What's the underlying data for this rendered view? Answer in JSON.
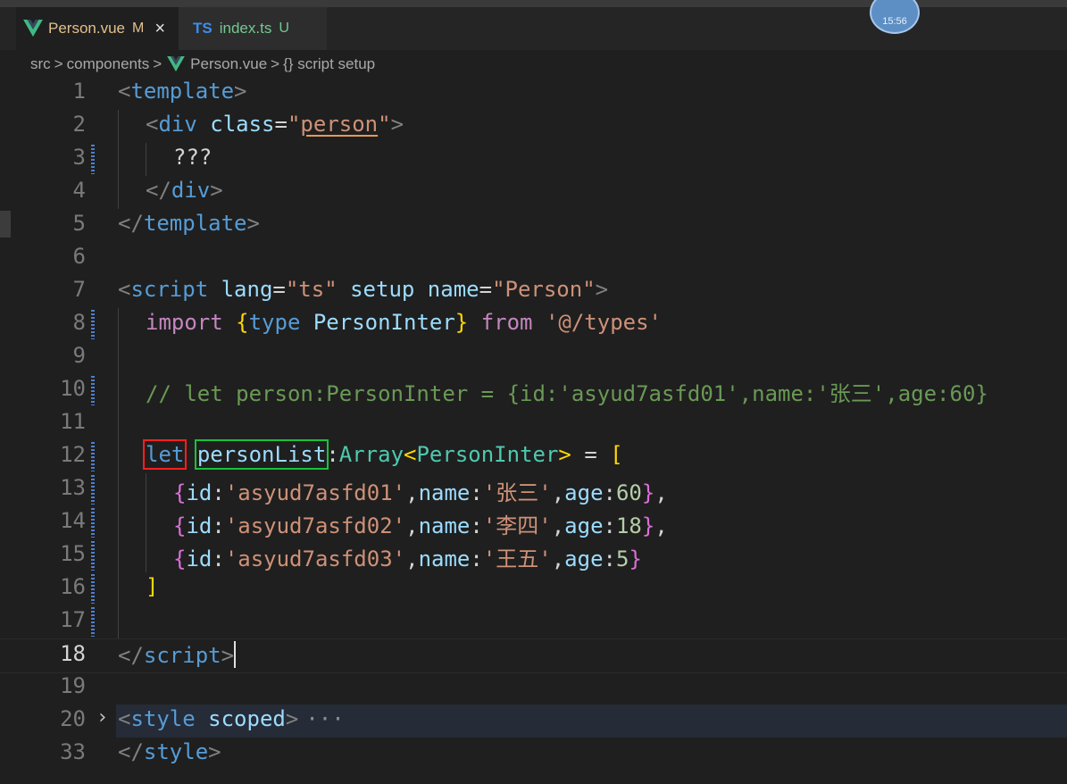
{
  "tabs": [
    {
      "label": "Person.vue",
      "flag": "M",
      "close": "×"
    },
    {
      "badge": "TS",
      "label": "index.ts",
      "flag": "U"
    }
  ],
  "clock": "15:56",
  "breadcrumb": {
    "parts": [
      "src",
      "components",
      "Person.vue",
      "{} script setup"
    ],
    "sep": ">"
  },
  "line_numbers": [
    "1",
    "2",
    "3",
    "4",
    "5",
    "6",
    "7",
    "8",
    "9",
    "10",
    "11",
    "12",
    "13",
    "14",
    "15",
    "16",
    "17",
    "18",
    "19",
    "20",
    "33"
  ],
  "code": {
    "l1": {
      "open": "<",
      "tag": "template",
      "close": ">"
    },
    "l2": {
      "open": "<",
      "tag": "div",
      "attr": " class",
      "eq": "=",
      "q1": "\"",
      "val": "person",
      "q2": "\"",
      "close": ">"
    },
    "l3": {
      "text": "???"
    },
    "l4": {
      "open": "</",
      "tag": "div",
      "close": ">"
    },
    "l5": {
      "open": "</",
      "tag": "template",
      "close": ">"
    },
    "l7": {
      "open": "<",
      "tag": "script",
      "a1": " lang",
      "eq1": "=",
      "v1": "\"ts\"",
      "a2": " setup",
      "a3": " name",
      "eq3": "=",
      "v3": "\"Person\"",
      "close": ">"
    },
    "l8": {
      "kw": "import",
      "b1": "{",
      "type_kw": "type",
      "name": " PersonInter",
      "b2": "}",
      "from": "from",
      "path": "'@/types'"
    },
    "l10": {
      "comment": "// let person:PersonInter = {id:'asyud7asfd01',name:'张三',age:60}"
    },
    "l12": {
      "let": "let",
      "var": "personList",
      "colon": ":",
      "arr": "Array",
      "lt": "<",
      "inter": "PersonInter",
      "gt": ">",
      "eq": " = ",
      "bracket": "["
    },
    "rows": [
      {
        "ob": "{",
        "idk": "id",
        "c1": ":",
        "id": "'asyud7asfd01'",
        "cm": ",",
        "nk": "name",
        "c2": ":",
        "name": "'张三'",
        "cm2": ",",
        "ak": "age",
        "c3": ":",
        "age": "60",
        "cb": "}",
        "end": ","
      },
      {
        "ob": "{",
        "idk": "id",
        "c1": ":",
        "id": "'asyud7asfd02'",
        "cm": ",",
        "nk": "name",
        "c2": ":",
        "name": "'李四'",
        "cm2": ",",
        "ak": "age",
        "c3": ":",
        "age": "18",
        "cb": "}",
        "end": ","
      },
      {
        "ob": "{",
        "idk": "id",
        "c1": ":",
        "id": "'asyud7asfd03'",
        "cm": ",",
        "nk": "name",
        "c2": ":",
        "name": "'王五'",
        "cm2": ",",
        "ak": "age",
        "c3": ":",
        "age": "5",
        "cb": "}",
        "end": ""
      }
    ],
    "l16": {
      "bracket": "]"
    },
    "l18": {
      "open": "</",
      "tag": "script",
      "close": ">"
    },
    "l20": {
      "arrow": "›",
      "open": "<",
      "tag": "style",
      "attr": " scoped",
      "close": ">",
      "ellipsis": "···"
    },
    "l33": {
      "open": "</",
      "tag": "style",
      "close": ">"
    }
  },
  "colors": {
    "tag": "#569cd6",
    "attr": "#9cdcfe",
    "string": "#ce9178",
    "keyword": "#c586c0",
    "type": "#4ec9b0",
    "comment": "#6a9955",
    "number": "#b5cea8",
    "highlight_red": "#ff1f1f",
    "highlight_green": "#19c23c"
  }
}
